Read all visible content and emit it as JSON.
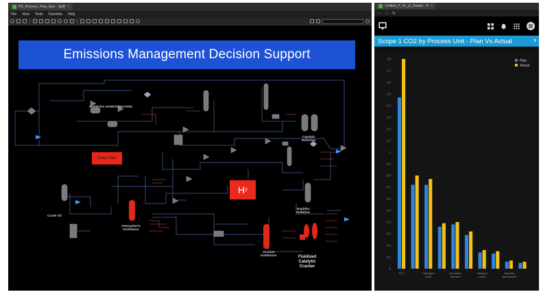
{
  "left_window": {
    "tab_title": "PR_Process_Flow_blue - SpiR",
    "menu": [
      "File",
      "View",
      "Tools",
      "Favorites",
      "Help"
    ],
    "search_placeholder": "",
    "banner_title": "Emissions Management Decision Support",
    "labels": {
      "naphtha_hydrotreating": "NAPHTHA HYDROTREATING",
      "catalytic_reformer": "Catalytic\nReformer",
      "naphtha_stabilizer": "Naphtha\nStabilizer",
      "crude_oil": "Crude Oil",
      "atmospheric_distillation": "Atmospheric\nDistillation",
      "vacuum_distillation": "Vacuum\nDistillation",
      "fluidized_catalytic_cracker": "Fluidized\nCatalytic\nCracker",
      "power_plant": "Power Plant",
      "h2": "H",
      "h2_sub": "2"
    }
  },
  "right_window": {
    "tab_title": "Untitled_P_VL_E_Details - P",
    "chart_title": "Scope 1 CO2 by Process Unit - Plan Vs Actual",
    "colors": {
      "plan": "#2f86dc",
      "actual": "#f2c21a",
      "title_bar": "#1c9ad6"
    }
  },
  "chart_data": {
    "type": "bar",
    "title": "Scope 1 CO2 by Process Unit - Plan Vs Actual",
    "categories": [
      "FCC",
      "",
      "Hydrogen plant",
      "",
      "Aromatics reformer",
      "",
      "Delayed coker",
      "",
      "Naphtha hydrotreater",
      ""
    ],
    "series": [
      {
        "name": "Plan",
        "values": [
          1.47,
          0.72,
          0.72,
          0.36,
          0.38,
          0.29,
          0.14,
          0.13,
          0.06,
          0.05
        ]
      },
      {
        "name": "Actual",
        "values": [
          1.8,
          0.8,
          0.77,
          0.39,
          0.4,
          0.32,
          0.16,
          0.15,
          0.07,
          0.06
        ]
      }
    ],
    "yticks": [
      "1.8",
      "1.7",
      "1.6",
      "1.5",
      "1.4",
      "1.3",
      "1.2",
      "1.1",
      "1",
      "0.9",
      "0.8",
      "0.7",
      "0.6",
      "0.5",
      "0.4",
      "0.3",
      "0.2",
      "0.1",
      "0"
    ],
    "ylim": [
      0,
      1.8
    ],
    "legend_position": "top-right",
    "xlabel": "",
    "ylabel": ""
  }
}
